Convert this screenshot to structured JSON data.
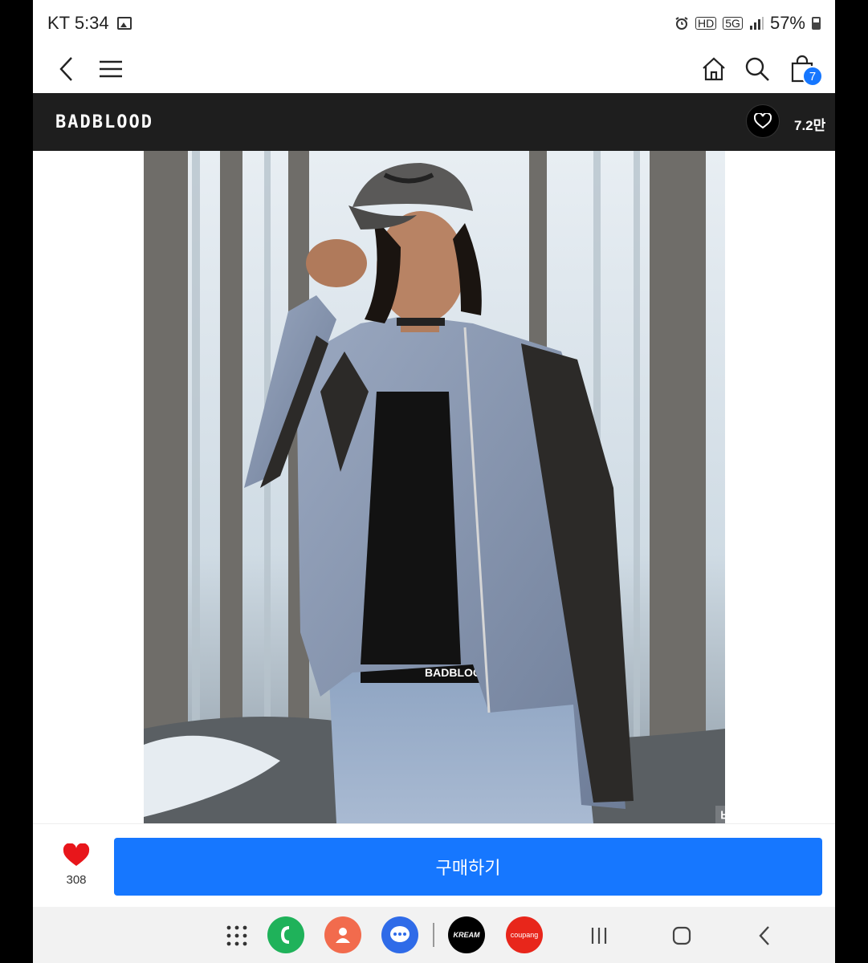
{
  "status_bar": {
    "carrier_time": "KT 5:34",
    "hd_label": "HD",
    "network": "5G",
    "battery": "57%"
  },
  "header": {
    "cart_count": "7"
  },
  "brand": {
    "name": "BADBLOOD",
    "likes": "7.2만"
  },
  "product": {
    "waistband_text": "BADBLOOD",
    "similar_style": "비슷한 스타일 >"
  },
  "purchase": {
    "wish_count": "308",
    "buy_label": "구매하기"
  },
  "nav_apps": {
    "kream_label": "KREAM",
    "coupang_label": "coupang"
  },
  "colors": {
    "accent_blue": "#1677ff",
    "brand_bar": "#1e1e1e",
    "heart_red": "#e8161b"
  }
}
